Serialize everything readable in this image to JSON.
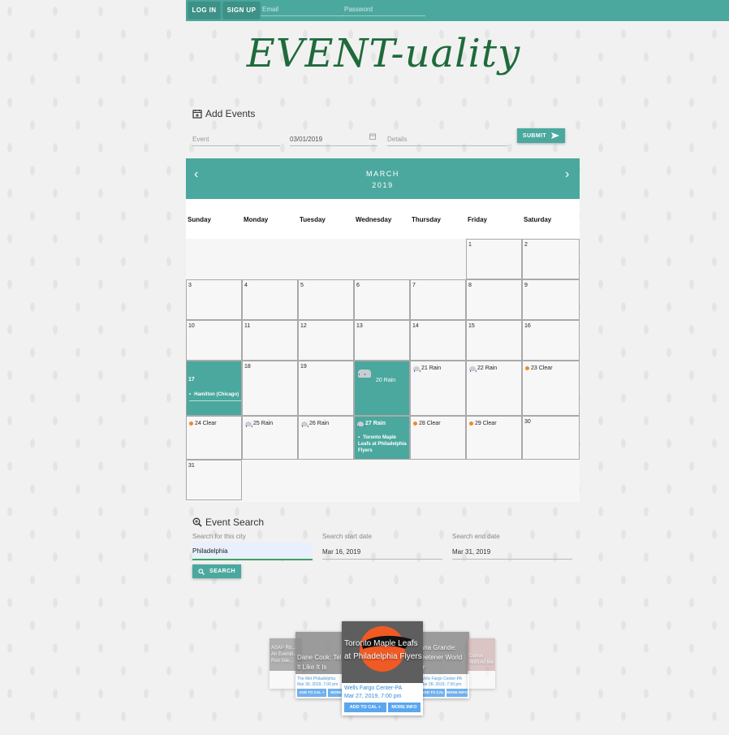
{
  "header": {
    "login_label": "LOG IN",
    "signup_label": "SIGN UP",
    "email_placeholder": "Email",
    "password_placeholder": "Password"
  },
  "logo": {
    "text": "EVENT-uality"
  },
  "add_events": {
    "title": "Add Events",
    "event_placeholder": "Event",
    "date_value": "03/01/2019",
    "details_placeholder": "Details",
    "submit_label": "SUBMIT"
  },
  "calendar": {
    "month": "MARCH",
    "year": "2019",
    "prev_glyph": "‹",
    "next_glyph": "›",
    "day_names": [
      "Sunday",
      "Monday",
      "Tuesday",
      "Wednesday",
      "Thursday",
      "Friday",
      "Saturday"
    ],
    "days": [
      {
        "d": "1",
        "col": 5,
        "row": 0
      },
      {
        "d": "2",
        "col": 6,
        "row": 0
      },
      {
        "d": "3",
        "col": 0,
        "row": 1
      },
      {
        "d": "4",
        "col": 1,
        "row": 1
      },
      {
        "d": "5",
        "col": 2,
        "row": 1
      },
      {
        "d": "6",
        "col": 3,
        "row": 1
      },
      {
        "d": "7",
        "col": 4,
        "row": 1
      },
      {
        "d": "8",
        "col": 5,
        "row": 1
      },
      {
        "d": "9",
        "col": 6,
        "row": 1
      },
      {
        "d": "10",
        "col": 0,
        "row": 2
      },
      {
        "d": "11",
        "col": 1,
        "row": 2
      },
      {
        "d": "12",
        "col": 2,
        "row": 2
      },
      {
        "d": "13",
        "col": 3,
        "row": 2
      },
      {
        "d": "14",
        "col": 4,
        "row": 2
      },
      {
        "d": "15",
        "col": 5,
        "row": 2
      },
      {
        "d": "16",
        "col": 6,
        "row": 2
      },
      {
        "d": "17",
        "col": 0,
        "row": 3,
        "hl": true,
        "event": "Hamilton (Chicago)"
      },
      {
        "d": "18",
        "col": 1,
        "row": 3
      },
      {
        "d": "19",
        "col": 2,
        "row": 3
      },
      {
        "d": "20",
        "col": 3,
        "row": 3,
        "hl": true,
        "weather": "Rain",
        "big": true
      },
      {
        "d": "21",
        "col": 4,
        "row": 3,
        "weather": "Rain"
      },
      {
        "d": "22",
        "col": 5,
        "row": 3,
        "weather": "Rain"
      },
      {
        "d": "23",
        "col": 6,
        "row": 3,
        "weather": "Clear"
      },
      {
        "d": "24",
        "col": 0,
        "row": 4,
        "weather": "Clear"
      },
      {
        "d": "25",
        "col": 1,
        "row": 4,
        "weather": "Rain"
      },
      {
        "d": "26",
        "col": 2,
        "row": 4,
        "weather": "Rain"
      },
      {
        "d": "27",
        "col": 3,
        "row": 4,
        "hl": true,
        "weather": "Rain",
        "event": "Toronto Maple Leafs at Philadelphia Flyers"
      },
      {
        "d": "28",
        "col": 4,
        "row": 4,
        "weather": "Clear"
      },
      {
        "d": "29",
        "col": 5,
        "row": 4,
        "weather": "Clear"
      },
      {
        "d": "30",
        "col": 6,
        "row": 4
      },
      {
        "d": "31",
        "col": 0,
        "row": 5
      }
    ]
  },
  "event_search": {
    "title": "Event Search",
    "city_label": "Search for this city",
    "city_value": "Philadelphia",
    "start_label": "Search start date",
    "start_value": "Mar 16, 2019",
    "end_label": "Search end date",
    "end_value": "Mar 31, 2019",
    "search_label": "SEARCH"
  },
  "carousel": {
    "left_far": {
      "title": "ASAP Ro... An Evenin... Ron Isle..."
    },
    "left": {
      "title": "Dane Cook: Tell It Like It Is",
      "venue": "The Met Philadelphia",
      "date": "Mar 30, 2019, 7:00 pm",
      "add_label": "ADD TO CAL +",
      "info_label": "MORE"
    },
    "center": {
      "title": "Toronto Maple Leafs at Philadelphia Flyers",
      "venue": "Wells Fargo Center-PA",
      "date": "Mar 27, 2019, 7:00 pm",
      "add_label": "ADD TO CAL +",
      "info_label": "MORE INFO"
    },
    "right": {
      "title": "Ariana Grande: Sweetener World Tour",
      "venue": "Wells Fargo Center-PA",
      "date": "Mar 28, 2019, 7:30 pm",
      "add_label": "ADD TO CAL +",
      "info_label": "MORE INFO"
    },
    "right_far": {
      "title": "Dance With All Me"
    }
  }
}
